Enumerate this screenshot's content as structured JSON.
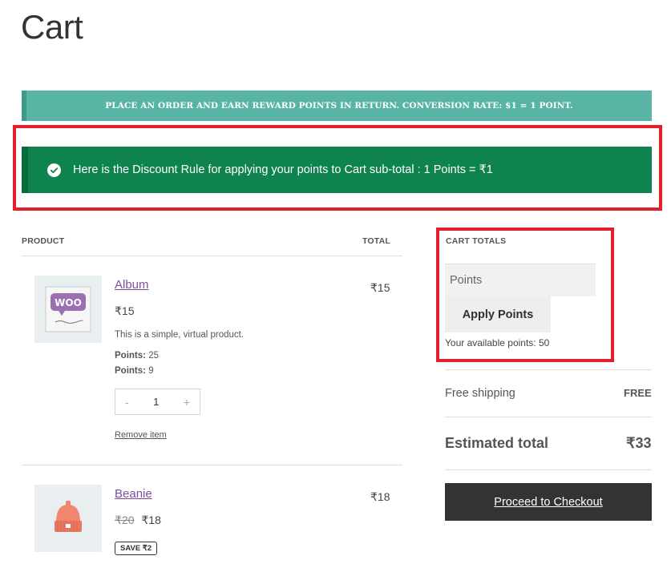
{
  "page": {
    "title": "Cart"
  },
  "reward_banner": {
    "text": "PLACE AN ORDER AND EARN REWARD POINTS IN RETURN. CONVERSION RATE: $1 = 1 POINT."
  },
  "success_notice": {
    "text": "Here is the Discount Rule for applying your points to Cart sub-total : 1 Points = ₹1"
  },
  "table": {
    "headers": {
      "product": "PRODUCT",
      "total": "TOTAL"
    },
    "items": [
      {
        "name": "Album",
        "price": "₹15",
        "description": "This is a simple, virtual product.",
        "points_label": "Points:",
        "points_values": [
          "25",
          "9"
        ],
        "quantity": "1",
        "qty_minus": "-",
        "qty_plus": "+",
        "remove_label": "Remove item",
        "total": "₹15",
        "thumb_text": "WOO"
      },
      {
        "name": "Beanie",
        "old_price": "₹20",
        "price": "₹18",
        "save_badge": "SAVE ₹2",
        "total": "₹18"
      }
    ]
  },
  "cart_totals": {
    "heading": "CART TOTALS",
    "points_placeholder": "Points",
    "apply_label": "Apply Points",
    "available_points": "Your available points: 50",
    "shipping_label": "Free shipping",
    "shipping_value": "FREE",
    "estimated_label": "Estimated total",
    "estimated_value": "₹33",
    "checkout_label": "Proceed to Checkout"
  },
  "colors": {
    "banner": "#58b4a5",
    "success": "#0f834d",
    "highlight": "#e3202b",
    "link": "#7b4f9e",
    "checkout": "#333333"
  }
}
